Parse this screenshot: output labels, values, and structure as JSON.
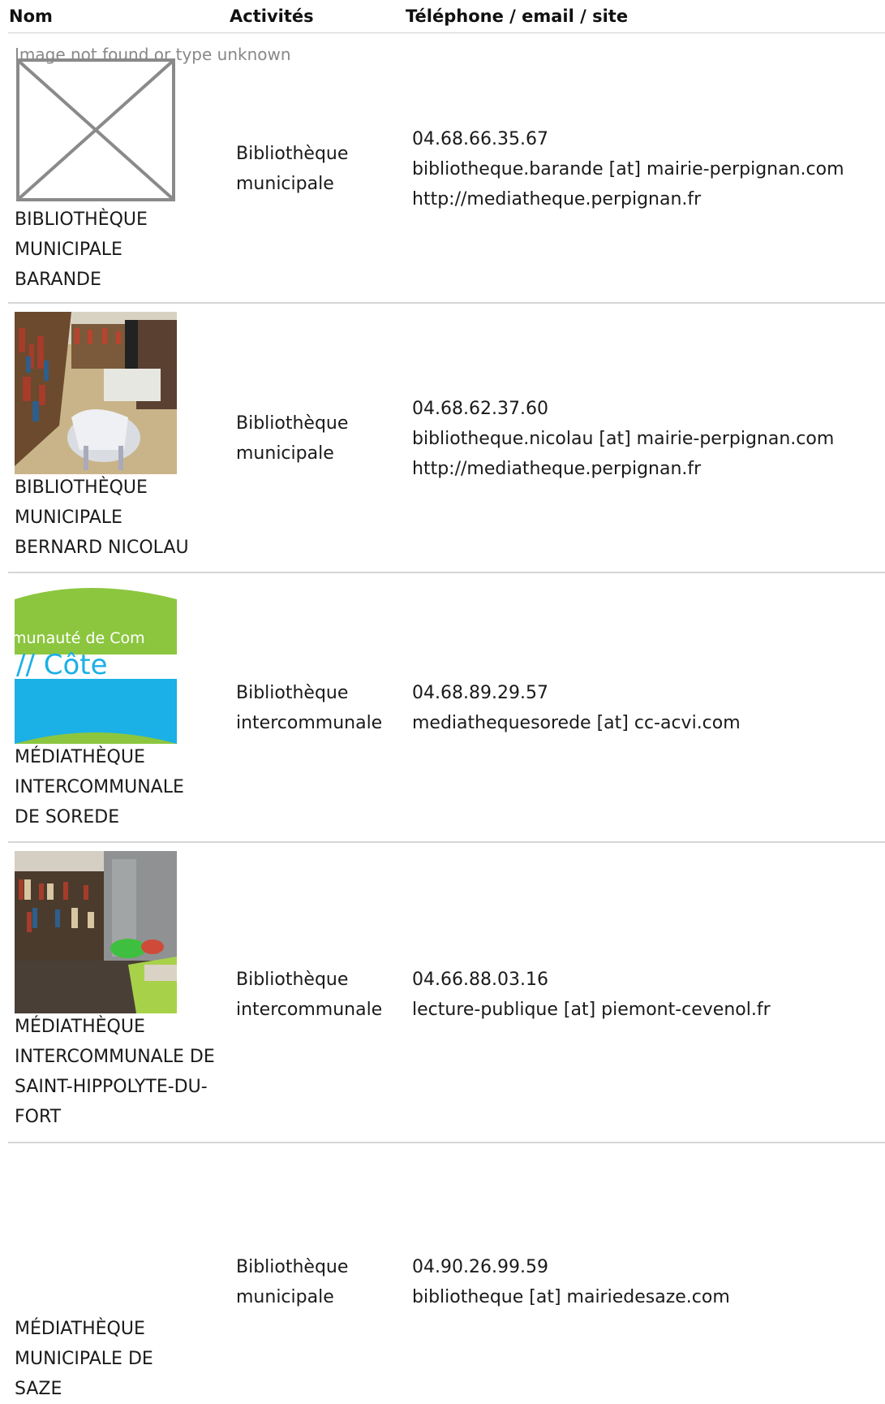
{
  "table": {
    "headers": {
      "nom": "Nom",
      "activites": "Activités",
      "contact": "Téléphone / email / site"
    },
    "rows": [
      {
        "image_alt": "Image not found or type unknown",
        "name": "BIBLIOTHÈQUE MUNICIPALE BARANDE",
        "activity": "Bibliothèque municipale",
        "phone": "04.68.66.35.67",
        "email": "bibliotheque.barande [at] mairie-perpignan.com",
        "site": "http://mediatheque.perpignan.fr"
      },
      {
        "name": "BIBLIOTHÈQUE MUNICIPALE BERNARD NICOLAU",
        "activity": "Bibliothèque municipale",
        "phone": "04.68.62.37.60",
        "email": "bibliotheque.nicolau [at] mairie-perpignan.com",
        "site": "http://mediatheque.perpignan.fr"
      },
      {
        "logo_line1": "munauté de Com",
        "logo_line2": "// Côte",
        "name": "MÉDIATHÈQUE INTERCOMMUNALE DE SOREDE",
        "activity": "Bibliothèque intercommunale",
        "phone": "04.68.89.29.57",
        "email": "mediathequesorede [at] cc-acvi.com"
      },
      {
        "name": "MÉDIATHÈQUE INTERCOMMUNALE DE SAINT-HIPPOLYTE-DU-FORT",
        "activity": "Bibliothèque intercommunale",
        "phone": "04.66.88.03.16",
        "email": "lecture-publique [at] piemont-cevenol.fr"
      },
      {
        "name": "MÉDIATHÈQUE MUNICIPALE DE SAZE",
        "activity": "Bibliothèque municipale",
        "phone": "04.90.26.99.59",
        "email": "bibliotheque [at] mairiedesaze.com"
      }
    ]
  }
}
